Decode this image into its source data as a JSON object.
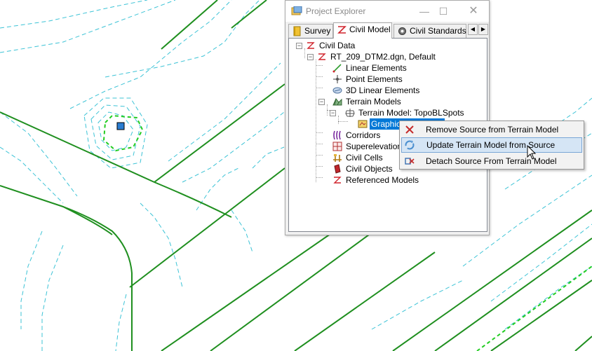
{
  "window": {
    "title": "Project Explorer",
    "close_glyph": "✕",
    "maximize_glyph": "☐",
    "minimize_glyph": "—"
  },
  "tabs": [
    {
      "label": "Survey",
      "icon": "survey-book-icon",
      "active": false
    },
    {
      "label": "Civil Model",
      "icon": "civil-model-icon",
      "active": true
    },
    {
      "label": "Civil Standards",
      "icon": "civil-standards-icon",
      "active": false
    }
  ],
  "tab_scroll": {
    "left": "◀",
    "right": "▶"
  },
  "tree": {
    "civil_data": "Civil Data",
    "model": "RT_209_DTM2.dgn, Default",
    "linear_elements": "Linear Elements",
    "point_elements": "Point Elements",
    "linear_3d": "3D Linear Elements",
    "terrain_models": "Terrain Models",
    "terrain_model": "Terrain Model: TopoBLSpots",
    "graphic_source": "Graphical Source...",
    "corridors": "Corridors",
    "superelevation": "Superelevation",
    "civil_cells": "Civil Cells",
    "civil_objects": "Civil Objects",
    "referenced_models": "Referenced Models",
    "expander_minus": "−"
  },
  "context_menu": {
    "items": [
      {
        "label": "Remove Source from Terrain Model",
        "icon": "remove-x-icon"
      },
      {
        "label": "Update Terrain Model from Source",
        "icon": "update-refresh-icon",
        "highlighted": true
      },
      {
        "label": "Detach Source From Terrain Model",
        "icon": "detach-icon"
      }
    ]
  },
  "colors": {
    "line_green": "#1a8a1a",
    "contour_cyan": "#3cc3d6",
    "selection_blue": "#0078d7",
    "menu_highlight": "#d5e5f5"
  }
}
